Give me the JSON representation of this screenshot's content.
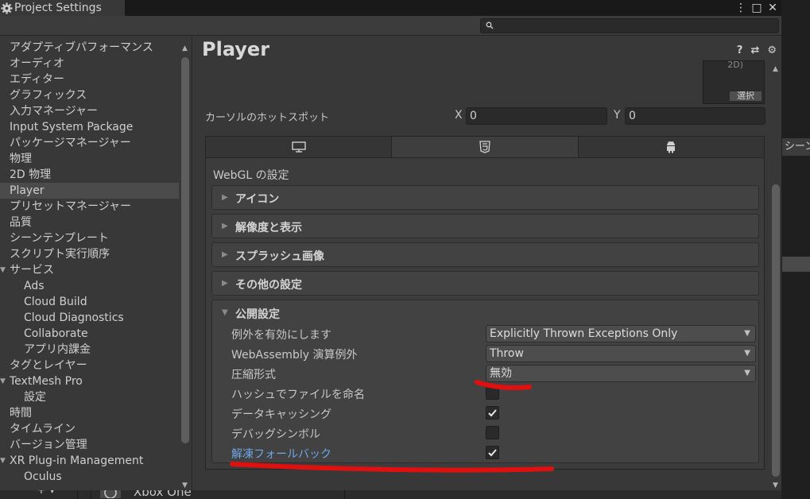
{
  "window": {
    "title": "Project Settings",
    "buttons": [
      "⋮",
      "□",
      "✕"
    ]
  },
  "search": {
    "placeholder": ""
  },
  "sidebar": {
    "items": [
      {
        "label": "アダプティブパフォーマンス",
        "level": 0
      },
      {
        "label": "オーディオ",
        "level": 0
      },
      {
        "label": "エディター",
        "level": 0
      },
      {
        "label": "グラフィックス",
        "level": 0
      },
      {
        "label": "入力マネージャー",
        "level": 0
      },
      {
        "label": "Input System Package",
        "level": 0
      },
      {
        "label": "パッケージマネージャー",
        "level": 0
      },
      {
        "label": "物理",
        "level": 0
      },
      {
        "label": "2D 物理",
        "level": 0
      },
      {
        "label": "Player",
        "level": 0,
        "selected": true
      },
      {
        "label": "プリセットマネージャー",
        "level": 0
      },
      {
        "label": "品質",
        "level": 0
      },
      {
        "label": "シーンテンプレート",
        "level": 0
      },
      {
        "label": "スクリプト実行順序",
        "level": 0
      },
      {
        "label": "サービス",
        "level": 0,
        "expanded": true
      },
      {
        "label": "Ads",
        "level": 1
      },
      {
        "label": "Cloud Build",
        "level": 1
      },
      {
        "label": "Cloud Diagnostics",
        "level": 1
      },
      {
        "label": "Collaborate",
        "level": 1
      },
      {
        "label": "アプリ内課金",
        "level": 1
      },
      {
        "label": "タグとレイヤー",
        "level": 0
      },
      {
        "label": "TextMesh Pro",
        "level": 0,
        "expanded": true
      },
      {
        "label": "設定",
        "level": 1
      },
      {
        "label": "時間",
        "level": 0
      },
      {
        "label": "タイムライン",
        "level": 0
      },
      {
        "label": "バージョン管理",
        "level": 0
      },
      {
        "label": "XR Plug-in Management",
        "level": 0,
        "expanded": true
      },
      {
        "label": "Oculus",
        "level": 1
      }
    ]
  },
  "main": {
    "title": "Player",
    "header_icons": [
      "help-icon",
      "presets-icon",
      "gear-icon"
    ],
    "icon_preview": {
      "partial_text": "2D)",
      "select_label": "選択"
    },
    "cursor_hotspot": {
      "label": "カーソルのホットスポット",
      "x_label": "X",
      "x_value": "0",
      "y_label": "Y",
      "y_value": "0"
    },
    "platform_tabs": [
      {
        "icon": "desktop-icon",
        "active": false
      },
      {
        "icon": "html5-icon",
        "active": true
      },
      {
        "icon": "android-icon",
        "active": false
      }
    ],
    "webgl_title": "WebGL の設定",
    "sections": [
      {
        "label": "アイコン",
        "expanded": false
      },
      {
        "label": "解像度と表示",
        "expanded": false
      },
      {
        "label": "スプラッシュ画像",
        "expanded": false
      },
      {
        "label": "その他の設定",
        "expanded": false
      }
    ],
    "publishing": {
      "label": "公開設定",
      "expanded": true,
      "rows": [
        {
          "label": "例外を有効にします",
          "type": "dropdown",
          "value": "Explicitly Thrown Exceptions Only"
        },
        {
          "label": "WebAssembly 演算例外",
          "type": "dropdown",
          "value": "Throw"
        },
        {
          "label": "圧縮形式",
          "type": "dropdown",
          "value": "無効"
        },
        {
          "label": "ハッシュでファイルを命名",
          "type": "checkbox",
          "checked": false
        },
        {
          "label": "データキャッシング",
          "type": "checkbox",
          "checked": true
        },
        {
          "label": "デバッグシンボル",
          "type": "checkbox",
          "checked": false
        },
        {
          "label": "解凍フォールバック",
          "type": "checkbox",
          "checked": true,
          "highlight": true
        }
      ]
    }
  },
  "right_strip": {
    "tab_label": "シーン"
  },
  "bottom": {
    "plus": "+ ▾",
    "item": "Xbox One"
  },
  "colors": {
    "accent_link": "#6fa6e8",
    "annotation": "#e01010"
  }
}
